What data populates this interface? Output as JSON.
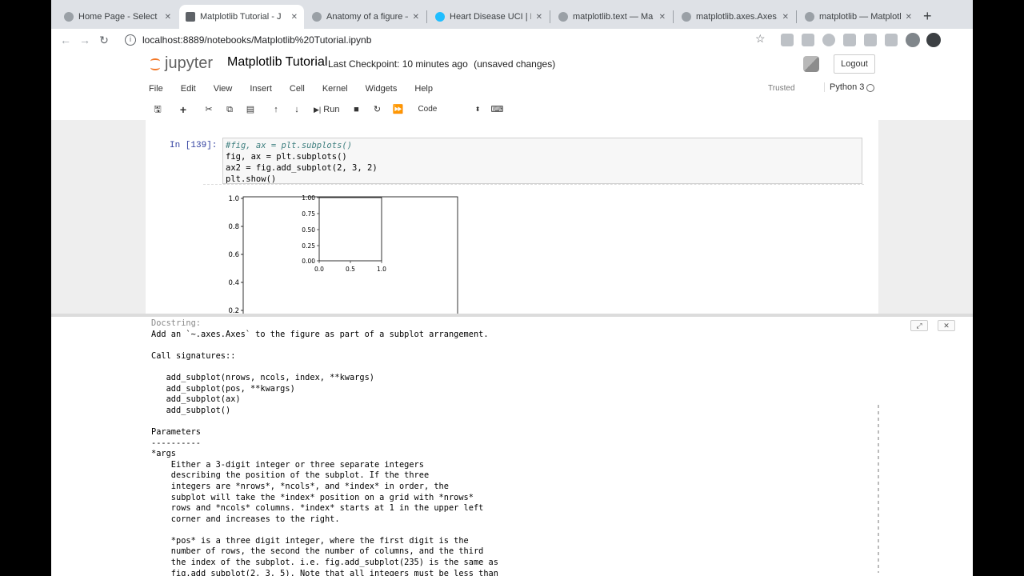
{
  "browser": {
    "tabs": [
      {
        "title": "Home Page - Select or",
        "active": false
      },
      {
        "title": "Matplotlib Tutorial - J",
        "active": true
      },
      {
        "title": "Anatomy of a figure —",
        "active": false
      },
      {
        "title": "Heart Disease UCI | K",
        "active": false
      },
      {
        "title": "matplotlib.text — Ma",
        "active": false
      },
      {
        "title": "matplotlib.axes.Axes.t",
        "active": false
      },
      {
        "title": "matplotlib — Matplotl",
        "active": false
      }
    ],
    "new_tab_label": "+",
    "url": "localhost:8889/notebooks/Matplotlib%20Tutorial.ipynb"
  },
  "jupyter": {
    "logo_text": "jupyter",
    "notebook_name": "Matplotlib Tutorial",
    "checkpoint": "Last Checkpoint: 10 minutes ago",
    "unsaved": "(unsaved changes)",
    "logout": "Logout",
    "menus": [
      "File",
      "Edit",
      "View",
      "Insert",
      "Cell",
      "Kernel",
      "Widgets",
      "Help"
    ],
    "trusted": "Trusted",
    "kernel": "Python 3",
    "run_label": "Run",
    "cell_type": "Code"
  },
  "cell": {
    "prompt": "In [139]:",
    "lines": [
      "#fig, ax = plt.subplots()",
      "fig, ax = plt.subplots()",
      "ax2 = fig.add_subplot(2, 3, 2)",
      "plt.show()"
    ]
  },
  "figure": {
    "main_yticks": [
      "1.0",
      "0.8",
      "0.6",
      "0.4",
      "0.2"
    ],
    "inset_yticks": [
      "1.00",
      "0.75",
      "0.50",
      "0.25",
      "0.00"
    ],
    "inset_xticks": [
      "0.0",
      "0.5",
      "1.0"
    ]
  },
  "pager": {
    "header": "Docstring:",
    "text": "Add an `~.axes.Axes` to the figure as part of a subplot arrangement.\n\nCall signatures::\n\n   add_subplot(nrows, ncols, index, **kwargs)\n   add_subplot(pos, **kwargs)\n   add_subplot(ax)\n   add_subplot()\n\nParameters\n----------\n*args\n    Either a 3-digit integer or three separate integers\n    describing the position of the subplot. If the three\n    integers are *nrows*, *ncols*, and *index* in order, the\n    subplot will take the *index* position on a grid with *nrows*\n    rows and *ncols* columns. *index* starts at 1 in the upper left\n    corner and increases to the right.\n\n    *pos* is a three digit integer, where the first digit is the\n    number of rows, the second the number of columns, and the third\n    the index of the subplot. i.e. fig.add_subplot(235) is the same as\n    fig.add_subplot(2, 3, 5). Note that all integers must be less than"
  }
}
